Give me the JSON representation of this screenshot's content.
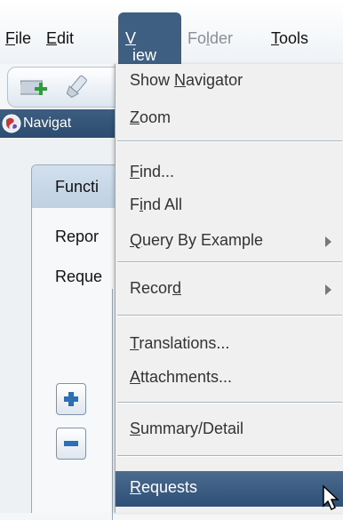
{
  "menubar": {
    "items": [
      {
        "label": "File",
        "mnemonic_prefix": "",
        "mnemonic": "F",
        "rest": "ile"
      },
      {
        "label": "Edit",
        "mnemonic_prefix": "",
        "mnemonic": "E",
        "rest": "dit"
      },
      {
        "label": "View",
        "mnemonic_prefix": "",
        "mnemonic": "V",
        "rest": "iew"
      },
      {
        "label": "Folder",
        "mnemonic_prefix": "Fo",
        "mnemonic": "l",
        "rest": "der"
      },
      {
        "label": "Tools",
        "mnemonic_prefix": "",
        "mnemonic": "T",
        "rest": "ools"
      }
    ]
  },
  "toolbar": {
    "icons": [
      "new-record-icon",
      "flashlight-icon"
    ]
  },
  "navigator": {
    "title": "Navigat",
    "icon": "globe-icon"
  },
  "panel": {
    "tab_label": "Functi",
    "items": [
      "Repor",
      "Reque"
    ]
  },
  "buttons": {
    "expand_icon": "plus-icon",
    "collapse_icon": "minus-icon"
  },
  "dropdown": {
    "items": [
      {
        "pre": "Show ",
        "mn": "N",
        "post": "avigator",
        "arrow": false
      },
      {
        "pre": "",
        "mn": "Z",
        "post": "oom",
        "arrow": false
      },
      {
        "pre": "",
        "mn": "F",
        "post": "ind...",
        "arrow": false
      },
      {
        "pre": "F",
        "mn": "i",
        "post": "nd All",
        "arrow": false
      },
      {
        "pre": "",
        "mn": "Q",
        "post": "uery By Example",
        "arrow": true
      },
      {
        "pre": "Recor",
        "mn": "d",
        "post": "",
        "arrow": true
      },
      {
        "pre": "",
        "mn": "T",
        "post": "ranslations...",
        "arrow": false
      },
      {
        "pre": "",
        "mn": "A",
        "post": "ttachments...",
        "arrow": false
      },
      {
        "pre": "",
        "mn": "S",
        "post": "ummary/Detail",
        "arrow": false
      },
      {
        "pre": "",
        "mn": "R",
        "post": "equests",
        "arrow": false
      }
    ],
    "highlighted": "Requests",
    "colors": {
      "highlight": "#3e5f82",
      "menu_bg": "#f0f0f0"
    }
  }
}
